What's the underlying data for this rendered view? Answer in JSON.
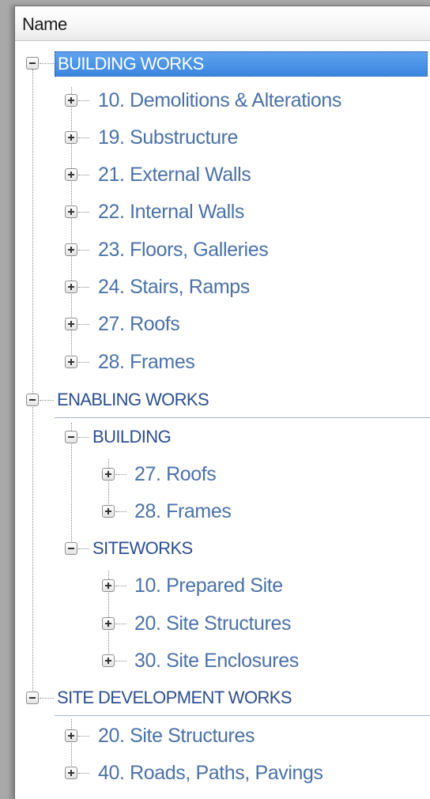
{
  "header": {
    "column_name": "Name"
  },
  "tree": {
    "building_works": {
      "label": "BUILDING WORKS",
      "children": [
        "10. Demolitions & Alterations",
        "19. Substructure",
        "21. External Walls",
        "22. Internal Walls",
        "23. Floors, Galleries",
        "24. Stairs, Ramps",
        "27. Roofs",
        "28. Frames"
      ]
    },
    "enabling_works": {
      "label": "ENABLING WORKS",
      "building": {
        "label": "BUILDING",
        "children": [
          "27. Roofs",
          "28. Frames"
        ]
      },
      "siteworks": {
        "label": "SITEWORKS",
        "children": [
          "10. Prepared Site",
          "20. Site Structures",
          "30. Site Enclosures"
        ]
      }
    },
    "site_development_works": {
      "label": "SITE DEVELOPMENT WORKS",
      "children": [
        "20. Site Structures",
        "40. Roads, Paths, Pavings"
      ]
    }
  },
  "colors": {
    "selection": "#3c86e0",
    "group_text": "#2c4f8f",
    "item_text": "#4b72a8"
  }
}
